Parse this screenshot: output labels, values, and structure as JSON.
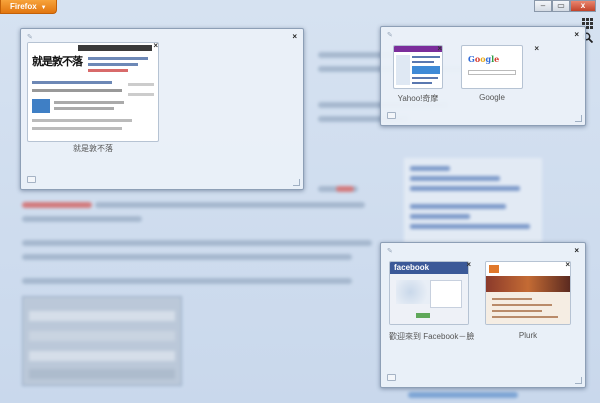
{
  "app": {
    "menu_button_label": "Firefox",
    "menu_button_arrow": "▼",
    "window_controls": {
      "minimize": "–",
      "restore": "▭",
      "close": "x"
    }
  },
  "toolbar": {
    "group_view_icon": "grid-icon",
    "search_icon": "search-icon"
  },
  "groups": [
    {
      "id": "group-left",
      "close_glyph": "×",
      "tabs": [
        {
          "label": "就是敦不落",
          "thumb_logo": "就是敦不落",
          "kind": "blog"
        }
      ]
    },
    {
      "id": "group-top-right",
      "close_glyph": "×",
      "tabs": [
        {
          "label": "Yahoo!奇摩",
          "kind": "yahoo"
        },
        {
          "label": "Google",
          "thumb_logo": "Google",
          "kind": "google"
        }
      ]
    },
    {
      "id": "group-bottom-right",
      "close_glyph": "×",
      "tabs": [
        {
          "label": "歡迎來到 Facebook－臉",
          "thumb_logo": "facebook",
          "kind": "facebook"
        },
        {
          "label": "Plurk",
          "kind": "plurk"
        }
      ]
    }
  ],
  "colors": {
    "firefox_orange": "#e2760f",
    "canvas_blue": "#cfdced",
    "facebook_blue": "#3b5998",
    "plurk_orange": "#e0782b"
  }
}
